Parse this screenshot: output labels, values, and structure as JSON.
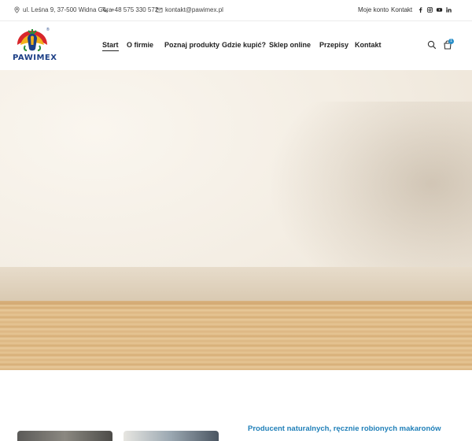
{
  "topbar": {
    "address": "ul. Leśna 9, 37-500 Widna Góra",
    "phone": "+48 575 330 572",
    "email": "kontakt@pawimex.pl",
    "account_link": "Moje konto",
    "contact_link": "Kontakt",
    "social_icons": [
      "facebook-icon",
      "instagram-icon",
      "youtube-icon",
      "linkedin-icon"
    ]
  },
  "header": {
    "logo_text": "PAWIMEX",
    "logo_mark": "®",
    "nav": [
      {
        "label": "Start",
        "active": true
      },
      {
        "label": "O firmie"
      },
      {
        "label": "Poznaj produkty"
      },
      {
        "label": "Gdzie kupić?"
      },
      {
        "label": "Sklep online"
      },
      {
        "label": "Przepisy"
      },
      {
        "label": "Kontakt"
      }
    ],
    "cart_count": "1"
  },
  "content": {
    "tagline": "Producent naturalnych, ręcznie robionych makaronów"
  },
  "colors": {
    "brand_blue": "#1c3f86",
    "accent": "#1f7fb8",
    "badge": "#2a8fc9"
  }
}
